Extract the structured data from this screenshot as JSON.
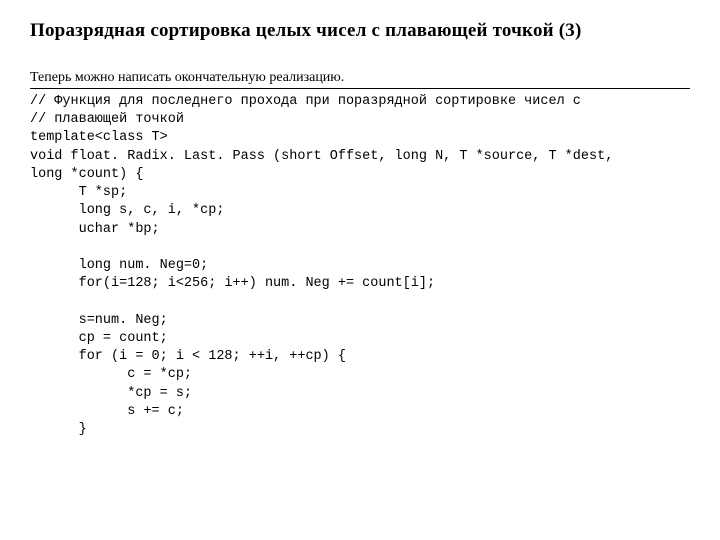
{
  "title": "Поразрядная сортировка целых чисел с плавающей точкой (3)",
  "intro": "Теперь можно написать окончательную реализацию.",
  "code": "// Функция для последнего прохода при поразрядной сортировке чисел с\n// плавающей точкой\ntemplate<class T>\nvoid float. Radix. Last. Pass (short Offset, long N, T *source, T *dest,\nlong *count) {\n      T *sp;\n      long s, c, i, *cp;\n      uchar *bp;\n\n      long num. Neg=0;\n      for(i=128; i<256; i++) num. Neg += count[i];\n\n      s=num. Neg;\n      cp = count;\n      for (i = 0; i < 128; ++i, ++cp) {\n            c = *cp;\n            *cp = s;\n            s += c;\n      }"
}
